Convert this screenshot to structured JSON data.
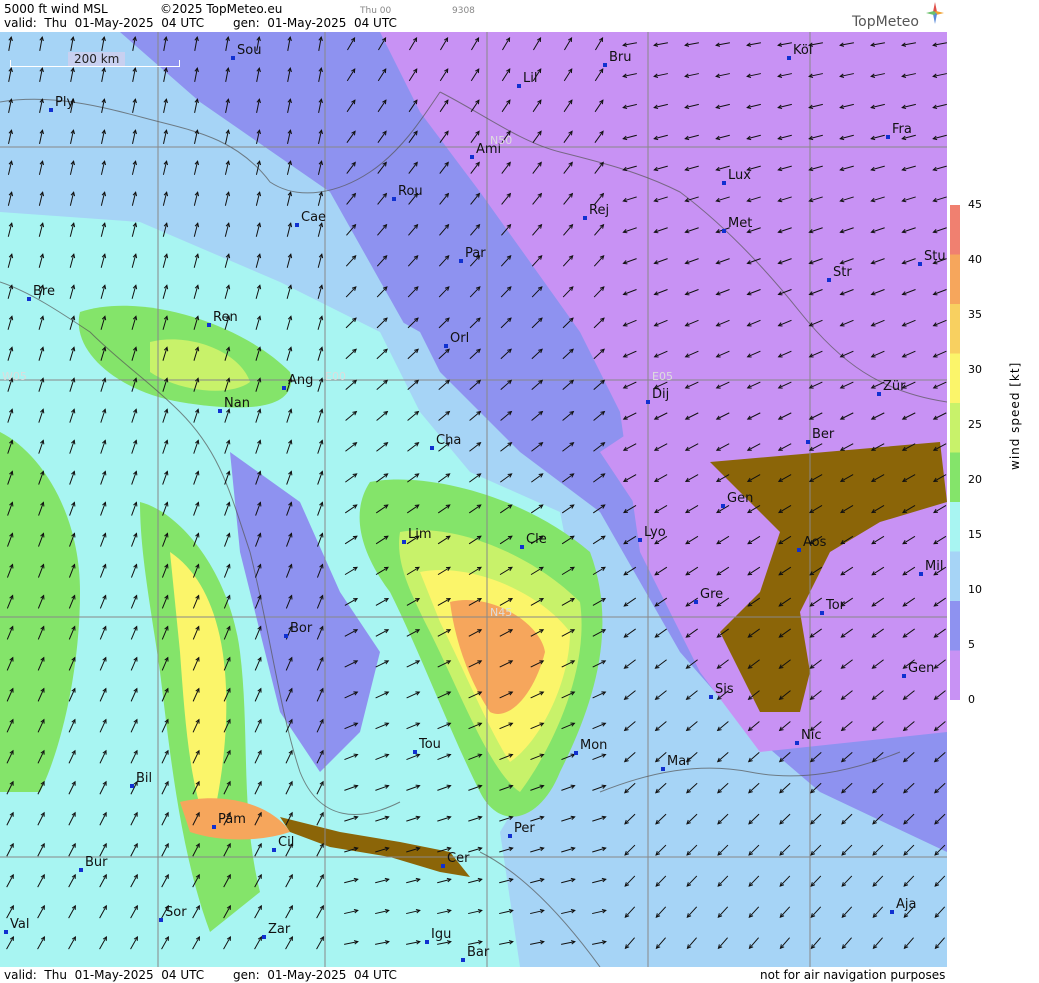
{
  "header": {
    "title": "5000 ft wind MSL",
    "copyright": "©2025 TopMeteo.eu",
    "valid": "valid:  Thu  01-May-2025  04 UTC",
    "gen": "gen:  01-May-2025  04 UTC",
    "small_day": "Thu 00",
    "small_code": "9308",
    "logo": "TopMeteo"
  },
  "scale": {
    "label": "200 km"
  },
  "legend": {
    "title": "wind  speed  [kt]",
    "ticks": [
      "45",
      "40",
      "35",
      "30",
      "25",
      "20",
      "15",
      "10",
      "5",
      "0"
    ],
    "colors": [
      "#f08070",
      "#f6a65c",
      "#f8d060",
      "#fbf56a",
      "#c8f26a",
      "#84e46a",
      "#a8f5f2",
      "#a6d4f6",
      "#8e92f0",
      "#c892f4"
    ]
  },
  "grid_labels": [
    "N50",
    "E05",
    "N45",
    "W05",
    "E00"
  ],
  "cities": [
    "Sou",
    "Ply",
    "Lil",
    "Bru",
    "Köl",
    "Ami",
    "Fra",
    "Lux",
    "Rou",
    "Cae",
    "Rej",
    "Met",
    "Par",
    "Stu",
    "Str",
    "Bre",
    "Ren",
    "Orl",
    "Ang",
    "Nan",
    "Dij",
    "Zür",
    "Ber",
    "Cha",
    "Gen",
    "Lim",
    "Cle",
    "Lyo",
    "Aos",
    "Mil",
    "Gre",
    "Tor",
    "Bor",
    "Sis",
    "Gen",
    "Tou",
    "Mon",
    "Nic",
    "Mar",
    "Bil",
    "Pam",
    "Cil",
    "Per",
    "Cer",
    "Bur",
    "Sor",
    "Ajа",
    "Val",
    "Zar",
    "Igu",
    "Bar"
  ],
  "footer": {
    "valid": "valid:  Thu  01-May-2025  04 UTC",
    "gen": "gen:  01-May-2025  04 UTC",
    "disclaimer": "not for air navigation purposes"
  }
}
